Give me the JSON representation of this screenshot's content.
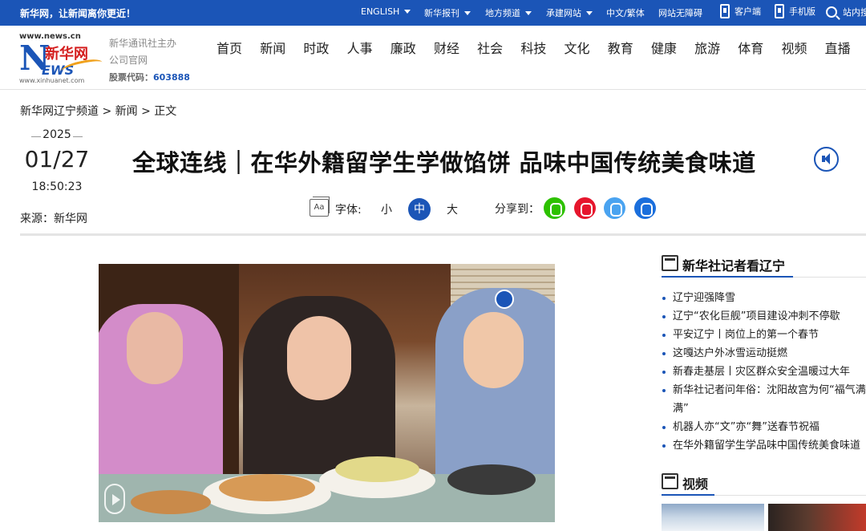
{
  "topbar": {
    "slogan": "新华网，让新闻离你更近！",
    "items": [
      {
        "label": "ENGLISH",
        "caret": true
      },
      {
        "label": "新华报刊",
        "caret": true
      },
      {
        "label": "地方频道",
        "caret": true
      },
      {
        "label": "承建网站",
        "caret": true
      },
      {
        "label": "中文/繁体",
        "caret": false
      },
      {
        "label": "网站无障碍",
        "caret": false
      }
    ],
    "client_label": "客户端",
    "mobile_label": "手机版",
    "search_label": "站内搜"
  },
  "header": {
    "logo": {
      "url": "www.news.cn",
      "brand": "新华网",
      "news_letters": "EWS",
      "n_letter": "N",
      "domain": "www.xinhuanet.com"
    },
    "sponsor_line1": "新华通讯社主办",
    "sponsor_line2": "公司官网",
    "stock_label": "股票代码：",
    "stock_code": "603888",
    "nav": [
      "首页",
      "新闻",
      "时政",
      "人事",
      "廉政",
      "财经",
      "社会",
      "科技",
      "文化",
      "教育",
      "健康",
      "旅游",
      "体育",
      "视频",
      "直播"
    ]
  },
  "breadcrumb": "新华网辽宁频道 > 新闻 > 正文",
  "article": {
    "year": "2025",
    "month_day": "01/27",
    "time": "18:50:23",
    "source": "来源：新华网",
    "title": "全球连线｜在华外籍留学生学做馅饼 品味中国传统美食味道",
    "font_label": "字体:",
    "font_icon_text": "Aa",
    "font_sizes": {
      "small": "小",
      "medium": "中",
      "large": "大"
    },
    "share_label": "分享到："
  },
  "sidebar": {
    "section_title": "新华社记者看辽宁",
    "items": [
      "辽宁迎强降雪",
      "辽宁“农化巨舰”项目建设冲刺不停歇",
      "平安辽宁丨岗位上的第一个春节",
      "这嘎达户外冰雪运动挺燃",
      "新春走基层丨灾区群众安全温暖过大年",
      "新华社记者问年俗：沈阳故宫为何“福气满满”",
      "机器人亦“文”亦“舞”送春节祝福",
      "在华外籍留学生学品味中国传统美食味道"
    ],
    "video_title": "视频"
  },
  "colors": {
    "brand_blue": "#1b55b7",
    "accent_red": "#d41d1d"
  }
}
